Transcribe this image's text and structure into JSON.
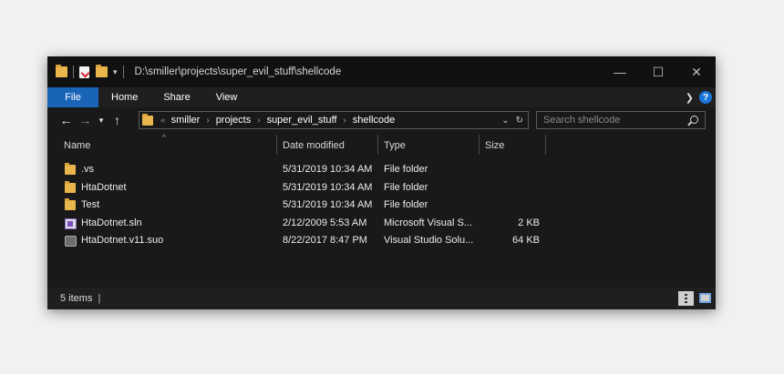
{
  "window": {
    "title_path": "D:\\smiller\\projects\\super_evil_stuff\\shellcode"
  },
  "ribbon": {
    "tabs": [
      "File",
      "Home",
      "Share",
      "View"
    ]
  },
  "address": {
    "crumbs": [
      "smiller",
      "projects",
      "super_evil_stuff",
      "shellcode"
    ]
  },
  "search": {
    "placeholder": "Search shellcode"
  },
  "columns": {
    "name": "Name",
    "date": "Date modified",
    "type": "Type",
    "size": "Size"
  },
  "files": [
    {
      "name": ".vs",
      "date": "5/31/2019 10:34 AM",
      "type": "File folder",
      "size": "",
      "icon": "folder-icon"
    },
    {
      "name": "HtaDotnet",
      "date": "5/31/2019 10:34 AM",
      "type": "File folder",
      "size": "",
      "icon": "folder-icon"
    },
    {
      "name": "Test",
      "date": "5/31/2019 10:34 AM",
      "type": "File folder",
      "size": "",
      "icon": "folder-icon"
    },
    {
      "name": "HtaDotnet.sln",
      "date": "2/12/2009 5:53 AM",
      "type": "Microsoft Visual S...",
      "size": "2 KB",
      "icon": "sln-file-icon"
    },
    {
      "name": "HtaDotnet.v11.suo",
      "date": "8/22/2017 8:47 PM",
      "type": "Visual Studio Solu...",
      "size": "64 KB",
      "icon": "suo-file-icon"
    }
  ],
  "status": {
    "item_count": "5 items"
  },
  "colors": {
    "accent": "#1a64b8",
    "background": "#191919",
    "folder": "#e8b64b"
  }
}
